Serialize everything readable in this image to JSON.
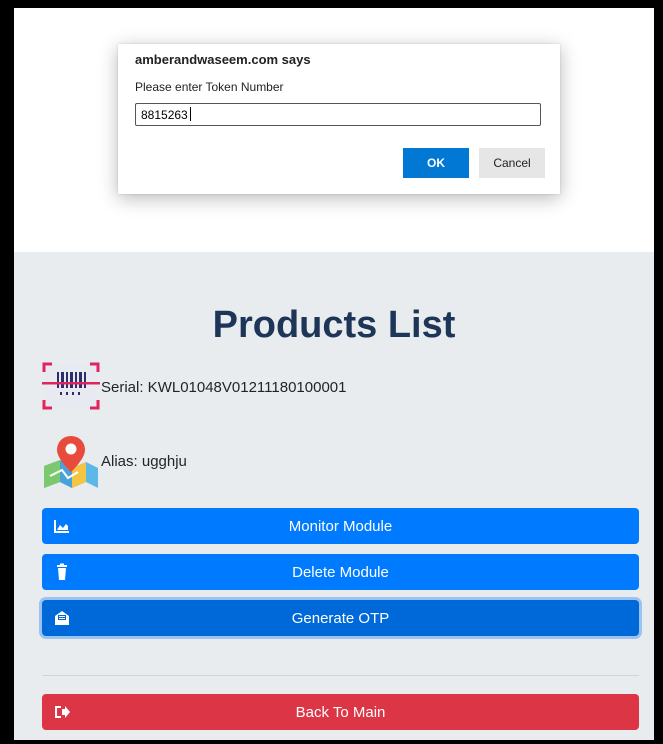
{
  "dialog": {
    "title": "amberandwaseem.com says",
    "message": "Please enter Token Number",
    "input_value": "8815263",
    "ok_label": "OK",
    "cancel_label": "Cancel"
  },
  "page": {
    "title": "Products List",
    "serial_text": "Serial: KWL01048V01211180100001",
    "alias_text": "Alias: ugghju"
  },
  "buttons": {
    "monitor": {
      "label": "Monitor Module",
      "icon": "chart-area-icon"
    },
    "delete": {
      "label": "Delete Module",
      "icon": "trash-icon"
    },
    "otp": {
      "label": "Generate OTP",
      "icon": "envelope-open-icon"
    },
    "back": {
      "label": "Back To Main",
      "icon": "sign-out-icon"
    }
  },
  "colors": {
    "primary": "#007bff",
    "primary_focused": "#0069d9",
    "danger": "#dc3545",
    "title": "#1d3557",
    "dialog_ok": "#0078d4"
  }
}
